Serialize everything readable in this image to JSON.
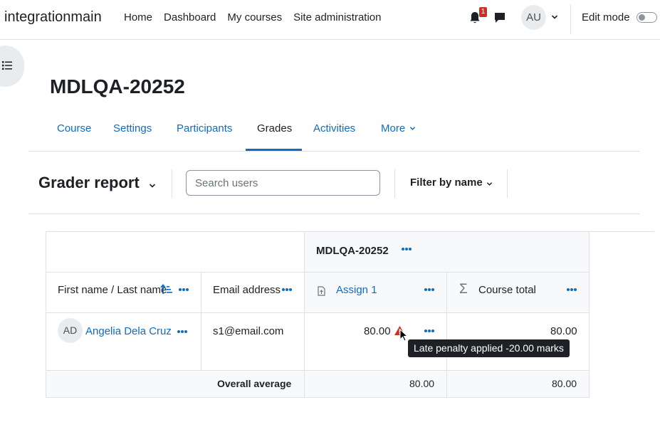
{
  "navbar": {
    "brand": "integrationmain",
    "links": [
      "Home",
      "Dashboard",
      "My courses",
      "Site administration"
    ],
    "notification_count": "1",
    "user_initials": "AU",
    "edit_mode_label": "Edit mode"
  },
  "page": {
    "title": "MDLQA-20252"
  },
  "secondary_nav": {
    "tabs": [
      {
        "label": "Course"
      },
      {
        "label": "Settings"
      },
      {
        "label": "Participants"
      },
      {
        "label": "Grades"
      },
      {
        "label": "Activities"
      },
      {
        "label": "More"
      }
    ],
    "active": "Grades"
  },
  "report": {
    "title": "Grader report",
    "search_placeholder": "Search users",
    "filter_label": "Filter by name"
  },
  "table": {
    "category_header": "MDLQA-20252",
    "columns": {
      "name": "First name / Last name",
      "email": "Email address",
      "assign": "Assign 1",
      "total": "Course total"
    },
    "rows": [
      {
        "initials": "AD",
        "name": "Angelia Dela Cruz",
        "email": "s1@email.com",
        "assign_grade": "80.00",
        "course_total": "80.00"
      }
    ],
    "average": {
      "label": "Overall average",
      "assign": "80.00",
      "total": "80.00"
    },
    "tooltip": "Late penalty applied -20.00 marks"
  },
  "colors": {
    "link": "#0f6cbf",
    "warning": "#ca3120",
    "border": "#dee2e6"
  }
}
